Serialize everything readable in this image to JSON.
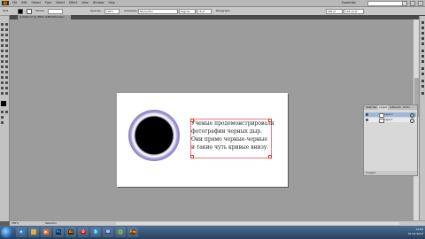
{
  "menubar": {
    "logo": "Ai",
    "menus": [
      "File",
      "Edit",
      "Object",
      "Type",
      "Select",
      "Effect",
      "View",
      "Window",
      "Help"
    ],
    "workspace": "Essentials",
    "search_placeholder": ""
  },
  "controlbar": {
    "selection_label": "Text",
    "stroke_label": "Stroke:",
    "stroke_value": "",
    "opacity_label": "Opacity:",
    "opacity_value": "100%",
    "character_label": "Character:",
    "font_value": "Myriad Pro",
    "font_style": "Regular",
    "font_size": "16 pt",
    "paragraph_label": "Paragraph:",
    "width_value": "286 pt",
    "height_value": "118,14 pt"
  },
  "document": {
    "tab_label": "Untitled-2* @ 300% (CMYK/Preview)"
  },
  "artboard": {
    "text_lines": [
      "Ученые продемонстрировали",
      "фотографии черных дыр.",
      "Они прямо черные-черные",
      "и такие чуть кривые внизу."
    ]
  },
  "statusbar": {
    "zoom": "300%",
    "tool_label": "Selection"
  },
  "layers_panel": {
    "tabs": [
      "Swatches",
      "Layers",
      "Artboards",
      "Colors"
    ],
    "rows": [
      {
        "name": "Layer 2",
        "selected": true
      },
      {
        "name": "Layer 1",
        "selected": false
      }
    ],
    "footer": "2 Layers"
  },
  "taskbar": {
    "apps": [
      "IE",
      "Explorer",
      "Media",
      "Ps",
      "Ai",
      "Opera",
      "Skype",
      "Word",
      "Chrome",
      "Fw"
    ],
    "time": "12:00",
    "date": "01.01.2013"
  },
  "colors": {
    "accent": "#ff9a00",
    "selection_red": "#e77777",
    "layer_selected": "#9fb8da"
  }
}
